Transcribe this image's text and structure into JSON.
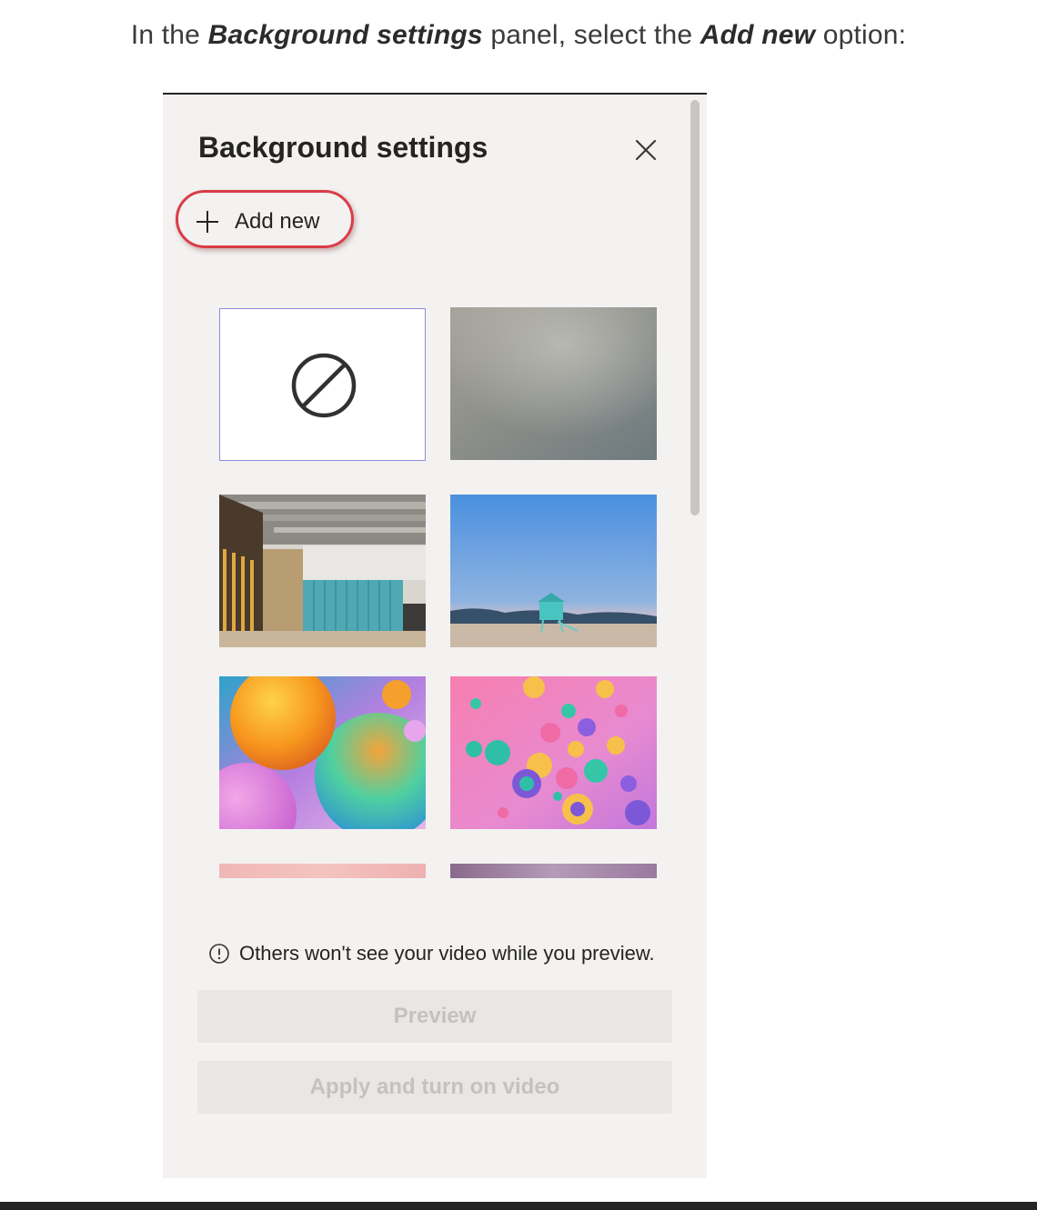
{
  "instruction": {
    "prefix": "In the ",
    "panel_name": "Background settings",
    "middle": " panel, select the ",
    "option_name": "Add new",
    "suffix": " option:"
  },
  "panel": {
    "title": "Background settings",
    "close_icon": "close-icon",
    "add_new": {
      "icon": "plus-icon",
      "label": "Add new",
      "highlight_color": "#d93d47"
    },
    "backgrounds": [
      {
        "name": "No background",
        "icon": "no-background-icon",
        "selected": true
      },
      {
        "name": "Blur"
      },
      {
        "name": "Office hallway"
      },
      {
        "name": "Beach lifeguard tower"
      },
      {
        "name": "Colorful spheres close-up"
      },
      {
        "name": "Floating colorful balls"
      },
      {
        "name": "Pink gradient"
      },
      {
        "name": "Purple gradient"
      }
    ],
    "info_text": "Others won't see your video while you preview.",
    "preview_button": "Preview",
    "apply_button": "Apply and turn on video"
  },
  "colors": {
    "panel_bg": "#f3f2f1",
    "selected_border": "#8d8fd6",
    "disabled_button_text": "#c4c2c0"
  }
}
